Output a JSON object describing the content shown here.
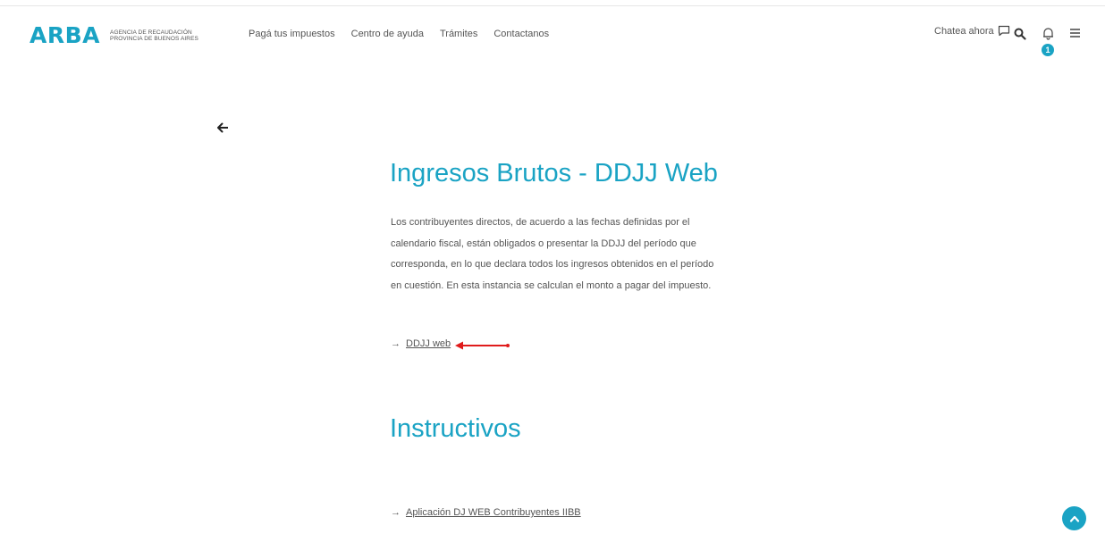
{
  "header": {
    "logo_text": "ARBA",
    "logo_sub_line1": "Agencia de Recaudación",
    "logo_sub_line2": "Provincia de Buenos Aires",
    "nav": [
      "Pagá tus impuestos",
      "Centro de ayuda",
      "Trámites",
      "Contactanos"
    ],
    "chat_label": "Chatea ahora",
    "notification_count": "1",
    "icons": [
      "chat-icon",
      "search-icon",
      "bell-icon",
      "menu-icon"
    ]
  },
  "main": {
    "title": "Ingresos Brutos - DDJJ Web",
    "description": "Los contribuyentes directos, de acuerdo a las fechas definidas por el calendario fiscal, están obligados o presentar la DDJJ del período que corresponda, en lo que declara todos los ingresos obtenidos en el período en cuestión. En esta instancia se calculan el monto a pagar del impuesto.",
    "link_arrow": "→",
    "link_label": "DDJJ web",
    "section_title": "Instructivos",
    "section_link_label": "Aplicación DJ WEB Contribuyentes IIBB"
  },
  "colors": {
    "accent": "#1aa3c4",
    "annotation_arrow": "#e01b1b"
  }
}
